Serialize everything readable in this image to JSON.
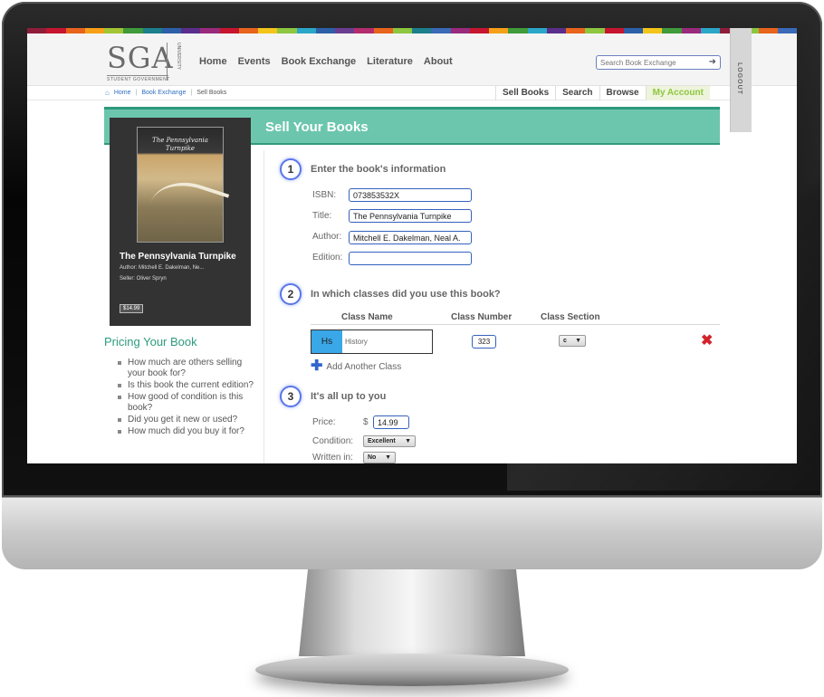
{
  "brand": {
    "logo_text": "SGA",
    "logo_subtext": "STUDENT GOVERNMENT",
    "logo_vertical_text": "UNIVERSITY"
  },
  "colors": {
    "accent": "#6cc6ad",
    "accent_dark": "#2f9a7c",
    "active_nav": "#8dc63f",
    "input_border": "#3462bc",
    "class_badge": "#3aa7e8",
    "remove": "#d2232a",
    "strip": [
      "#8f1d3a",
      "#c7152f",
      "#e8641c",
      "#f6a01a",
      "#a1c534",
      "#3f9b3a",
      "#1b7f8c",
      "#2c5fa8",
      "#5a2d8c",
      "#9a2a7c",
      "#c7152f",
      "#e8641c",
      "#f3c51a",
      "#8dc63f",
      "#2aa6c8",
      "#2c5fa8",
      "#6b3d91",
      "#b42c6d",
      "#e8641c",
      "#8dc63f",
      "#1b7f8c",
      "#3a6ab8",
      "#9a2a7c",
      "#c7152f",
      "#f6a01a",
      "#3f9b3a",
      "#2aa6c8",
      "#5a2d8c",
      "#e8641c",
      "#8dc63f",
      "#c7152f",
      "#2c5fa8",
      "#f3c51a",
      "#3f9b3a",
      "#9a2a7c",
      "#2aa6c8",
      "#8f1d3a",
      "#8dc63f",
      "#e8641c",
      "#3a6ab8"
    ]
  },
  "nav": {
    "home": "Home",
    "events": "Events",
    "book_exchange": "Book Exchange",
    "literature": "Literature",
    "about": "About"
  },
  "search": {
    "placeholder": "Search Book Exchange",
    "arrow_icon": "arrow-right-icon"
  },
  "logout": "LOGOUT",
  "breadcrumb": {
    "home": "Home",
    "book_exchange": "Book Exchange",
    "current": "Sell Books"
  },
  "subnav": {
    "sell": "Sell Books",
    "search": "Search",
    "browse": "Browse",
    "account": "My Account"
  },
  "page_title": "Sell Your Books",
  "book": {
    "cover_title": "The Pennsylvania Turnpike",
    "title": "The Pennsylvania Turnpike",
    "author": "Author: Mitchell E. Dakelman, Ne...",
    "seller": "Seller: Oliver Spryn",
    "price": "$14.99"
  },
  "pricing": {
    "title": "Pricing Your Book",
    "items": [
      "How much are others selling your book for?",
      "Is this book the current edition?",
      "How good of condition is this book?",
      "Did you get it new or used?",
      "How much did you buy it for?"
    ]
  },
  "step1": {
    "num": "1",
    "heading": "Enter the book's information",
    "isbn_label": "ISBN:",
    "isbn_value": "073853532X",
    "title_label": "Title:",
    "title_value": "The Pennsylvania Turnpike",
    "author_label": "Author:",
    "author_value": "Mitchell E. Dakelman, Neal A.",
    "edition_label": "Edition:",
    "edition_value": ""
  },
  "step2": {
    "num": "2",
    "heading": "In which classes did you use this book?",
    "col_name": "Class Name",
    "col_number": "Class Number",
    "col_section": "Class Section",
    "row": {
      "abbr": "Hs",
      "name": "History",
      "number": "323",
      "section": "c"
    },
    "add_label": "Add Another Class"
  },
  "step3": {
    "num": "3",
    "heading": "It's all up to you",
    "price_label": "Price:",
    "currency": "$",
    "price_value": "14.99",
    "condition_label": "Condition:",
    "condition_value": "Excellent",
    "written_label": "Written in:",
    "written_value": "No"
  }
}
